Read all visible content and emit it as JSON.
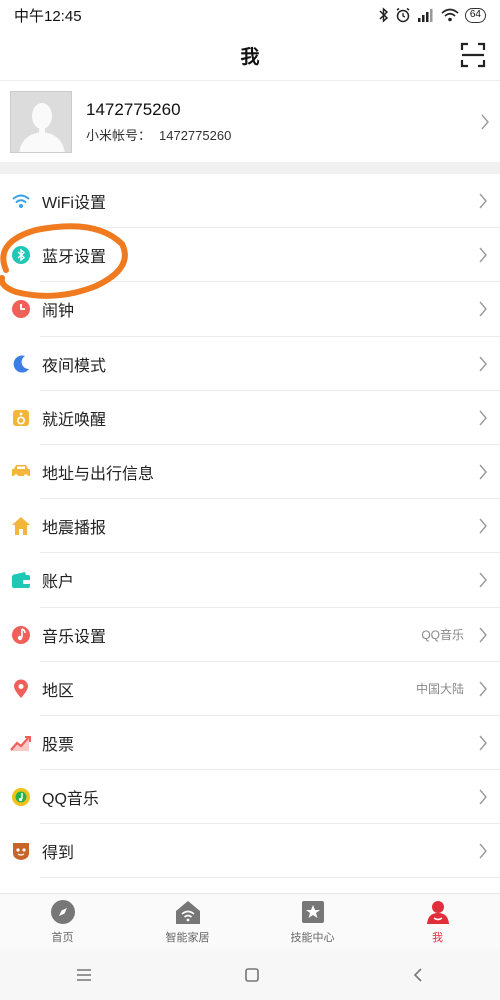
{
  "status": {
    "time": "中午12:45",
    "battery": "64"
  },
  "header": {
    "title": "我",
    "scan_icon": "scan-icon"
  },
  "profile": {
    "name": "1472775260",
    "account_label": "小米帐号：",
    "account_id": "1472775260"
  },
  "menu": [
    {
      "label": "WiFi设置",
      "value": "",
      "icon": "wifi-icon",
      "color": "#3aa0e8"
    },
    {
      "label": "蓝牙设置",
      "value": "",
      "icon": "bluetooth-icon",
      "color": "#1ec8b4"
    },
    {
      "label": "闹钟",
      "value": "",
      "icon": "alarm-icon",
      "color": "#f0605a"
    },
    {
      "label": "夜间模式",
      "value": "",
      "icon": "moon-icon",
      "color": "#3d7de6"
    },
    {
      "label": "就近唤醒",
      "value": "",
      "icon": "speaker-icon",
      "color": "#f3b53a"
    },
    {
      "label": "地址与出行信息",
      "value": "",
      "icon": "car-icon",
      "color": "#f3b53a"
    },
    {
      "label": "地震播报",
      "value": "",
      "icon": "house-icon",
      "color": "#f3b53a"
    },
    {
      "label": "账户",
      "value": "",
      "icon": "wallet-icon",
      "color": "#1ec8b4"
    },
    {
      "label": "音乐设置",
      "value": "QQ音乐",
      "icon": "music-icon",
      "color": "#f0605a"
    },
    {
      "label": "地区",
      "value": "中国大陆",
      "icon": "location-icon",
      "color": "#f0605a"
    },
    {
      "label": "股票",
      "value": "",
      "icon": "stock-icon",
      "color": "#f0605a"
    },
    {
      "label": "QQ音乐",
      "value": "",
      "icon": "qqmusic-icon",
      "color": "#f3c21a"
    },
    {
      "label": "得到",
      "value": "",
      "icon": "dedao-icon",
      "color": "#c8642a"
    }
  ],
  "tabs": [
    {
      "label": "首页",
      "icon": "compass-icon",
      "active": false
    },
    {
      "label": "智能家居",
      "icon": "smart-home-icon",
      "active": false
    },
    {
      "label": "技能中心",
      "icon": "skill-star-icon",
      "active": false
    },
    {
      "label": "我",
      "icon": "user-icon",
      "active": true
    }
  ],
  "colors": {
    "accent": "#e02f3b",
    "annotation": "#f07a20"
  }
}
